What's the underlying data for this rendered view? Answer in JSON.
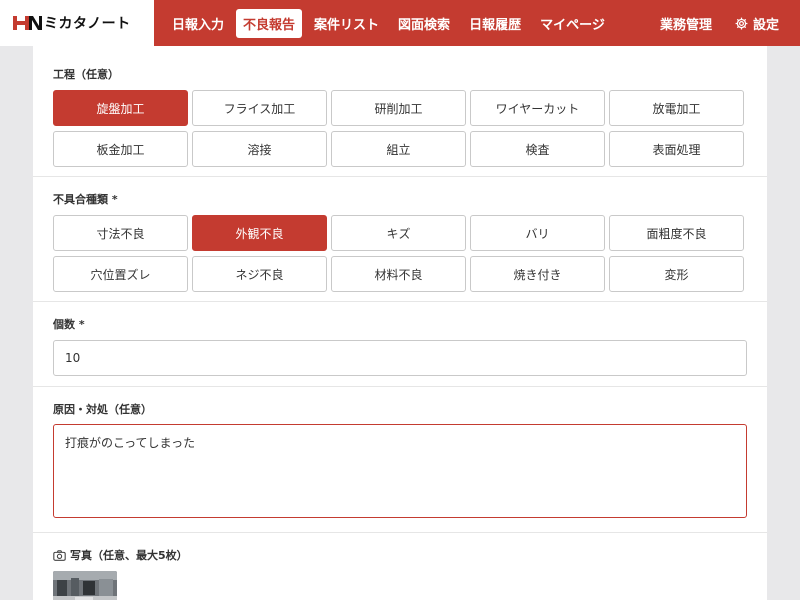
{
  "app": {
    "logo_text": "ミカタノート"
  },
  "nav": {
    "items": [
      "日報入力",
      "不良報告",
      "案件リスト",
      "図面検索",
      "日報履歴",
      "マイページ"
    ],
    "active_index": 1,
    "right": {
      "management": "業務管理",
      "settings": "設定"
    }
  },
  "process": {
    "label": "工程（任意）",
    "options": [
      "旋盤加工",
      "フライス加工",
      "研削加工",
      "ワイヤーカット",
      "放電加工",
      "板金加工",
      "溶接",
      "組立",
      "検査",
      "表面処理"
    ],
    "selected": "旋盤加工"
  },
  "defect": {
    "label": "不具合種類 *",
    "options": [
      "寸法不良",
      "外観不良",
      "キズ",
      "バリ",
      "面粗度不良",
      "穴位置ズレ",
      "ネジ不良",
      "材料不良",
      "焼き付き",
      "変形"
    ],
    "selected": "外観不良"
  },
  "quantity": {
    "label": "個数 *",
    "value": "10"
  },
  "cause": {
    "label": "原因・対処（任意）",
    "value": "打痕がのこってしまった"
  },
  "photo": {
    "label": "写真（任意、最大5枚）"
  },
  "colors": {
    "brand": "#c43b30",
    "panel_bg": "#ffffff",
    "page_bg": "#e8e8ea"
  }
}
